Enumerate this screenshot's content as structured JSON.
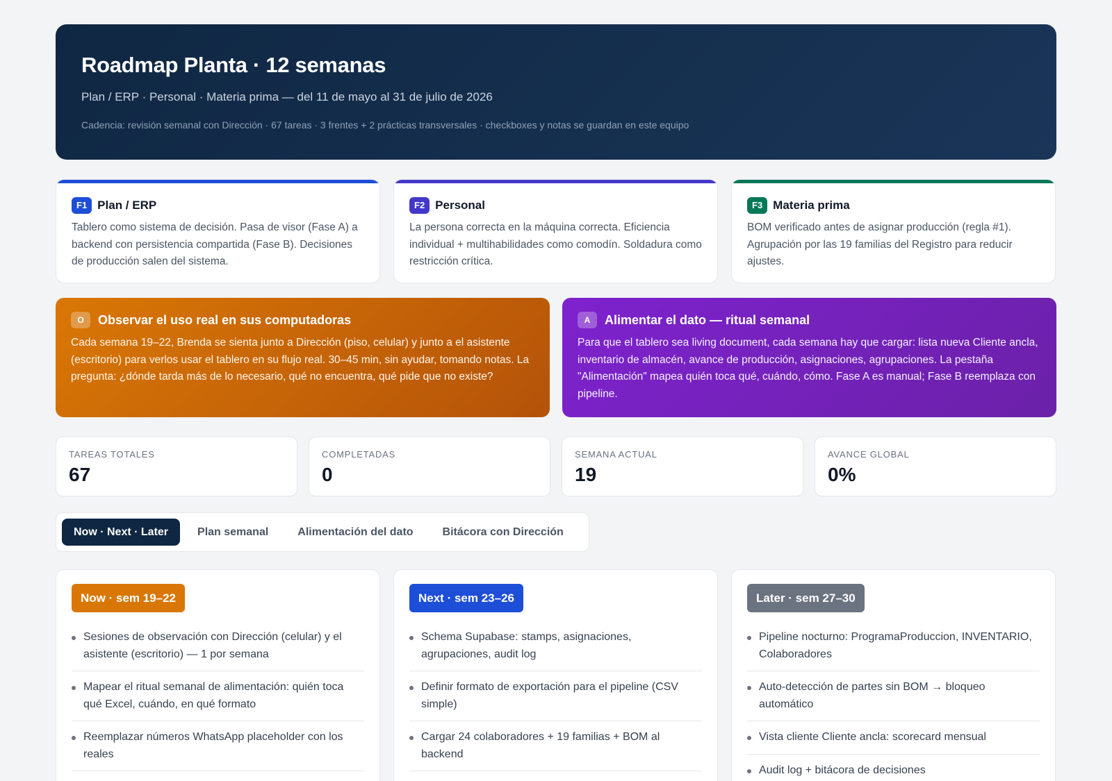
{
  "header": {
    "title": "Roadmap Planta · 12 semanas",
    "subtitle": "Plan / ERP · Personal · Materia prima — del 11 de mayo al 31 de julio de 2026",
    "meta": "Cadencia: revisión semanal con Dirección · 67 tareas · 3 frentes + 2 prácticas transversales · checkboxes y notas se guardan en este equipo"
  },
  "fronts": [
    {
      "badge": "F1",
      "title": "Plan / ERP",
      "color": "#1d4ed8",
      "desc": "Tablero como sistema de decisión. Pasa de visor (Fase A) a backend con persistencia compartida (Fase B). Decisiones de producción salen del sistema."
    },
    {
      "badge": "F2",
      "title": "Personal",
      "color": "#4338ca",
      "desc": "La persona correcta en la máquina correcta. Eficiencia individual + multihabilidades como comodín. Soldadura como restricción crítica."
    },
    {
      "badge": "F3",
      "title": "Materia prima",
      "color": "#047857",
      "desc": "BOM verificado antes de asignar producción (regla #1). Agrupación por las 19 familias del Registro para reducir ajustes."
    }
  ],
  "practices": [
    {
      "badge": "O",
      "title": "Observar el uso real en sus computadoras",
      "desc": "Cada semana 19–22, Brenda se sienta junto a Dirección (piso, celular) y junto a el asistente (escritorio) para verlos usar el tablero en su flujo real. 30–45 min, sin ayudar, tomando notas. La pregunta: ¿dónde tarda más de lo necesario, qué no encuentra, qué pide que no existe?"
    },
    {
      "badge": "A",
      "title": "Alimentar el dato — ritual semanal",
      "desc": "Para que el tablero sea living document, cada semana hay que cargar: lista nueva Cliente ancla, inventario de almacén, avance de producción, asignaciones, agrupaciones. La pestaña \"Alimentación\" mapea quién toca qué, cuándo, cómo. Fase A es manual; Fase B reemplaza con pipeline."
    }
  ],
  "stats": [
    {
      "label": "Tareas totales",
      "value": "67"
    },
    {
      "label": "Completadas",
      "value": "0"
    },
    {
      "label": "Semana actual",
      "value": "19"
    },
    {
      "label": "Avance global",
      "value": "0%"
    }
  ],
  "tabs": [
    {
      "label": "Now · Next · Later",
      "active": true
    },
    {
      "label": "Plan semanal",
      "active": false
    },
    {
      "label": "Alimentación del dato",
      "active": false
    },
    {
      "label": "Bitácora con Dirección",
      "active": false
    }
  ],
  "board": [
    {
      "label": "Now · sem 19–22",
      "color": "#d97706",
      "items": [
        "Sesiones de observación con Dirección (celular) y el asistente (escritorio) — 1 por semana",
        "Mapear el ritual semanal de alimentación: quién toca qué Excel, cuándo, en qué formato",
        "Reemplazar números WhatsApp placeholder con los reales"
      ]
    },
    {
      "label": "Next · sem 23–26",
      "color": "#1d4ed8",
      "items": [
        "Schema Supabase: stamps, asignaciones, agrupaciones, audit log",
        "Definir formato de exportación para el pipeline (CSV simple)",
        "Cargar 24 colaboradores + 19 familias + BOM al backend"
      ]
    },
    {
      "label": "Later · sem 27–30",
      "color": "#6b7280",
      "items": [
        "Pipeline nocturno: ProgramaProduccion, INVENTARIO, Colaboradores",
        "Auto-detección de partes sin BOM → bloqueo automático",
        "Vista cliente Cliente ancla: scorecard mensual",
        "Audit log + bitácora de decisiones"
      ]
    }
  ]
}
